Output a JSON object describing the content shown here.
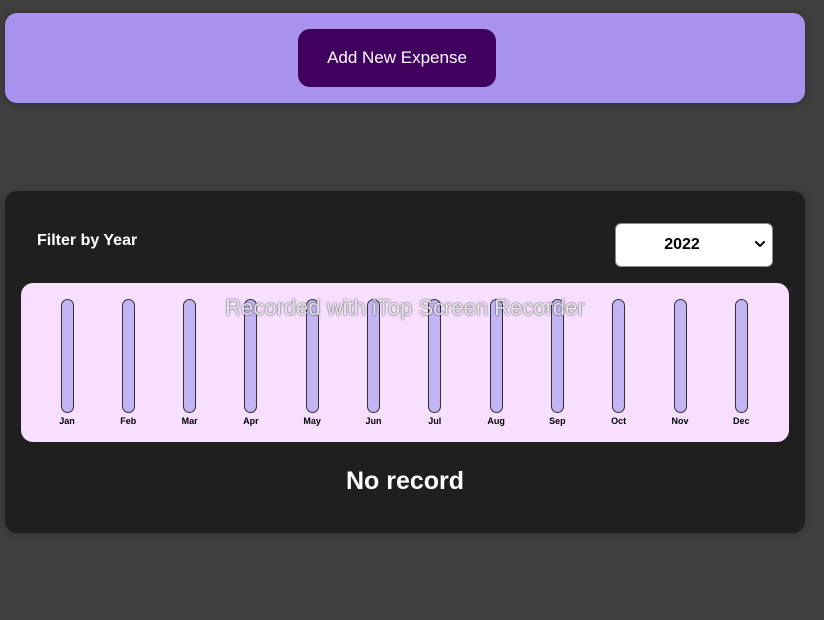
{
  "new_expense": {
    "add_button_label": "Add New Expense"
  },
  "filter": {
    "label": "Filter by Year",
    "selected_year": "2022"
  },
  "chart_data": {
    "type": "bar",
    "categories": [
      "Jan",
      "Feb",
      "Mar",
      "Apr",
      "May",
      "Jun",
      "Jul",
      "Aug",
      "Sep",
      "Oct",
      "Nov",
      "Dec"
    ],
    "values": [
      0,
      0,
      0,
      0,
      0,
      0,
      0,
      0,
      0,
      0,
      0,
      0
    ]
  },
  "watermark": "Recorded with iTop Screen Recorder",
  "empty_message": "No record",
  "colors": {
    "page_background": "#3f3f3f",
    "header_panel": "#a892ee",
    "add_button": "#40005d",
    "expenses_panel": "#1f1f1f",
    "chart_background": "#f8dfff",
    "bar_track": "#c3b4f3"
  }
}
